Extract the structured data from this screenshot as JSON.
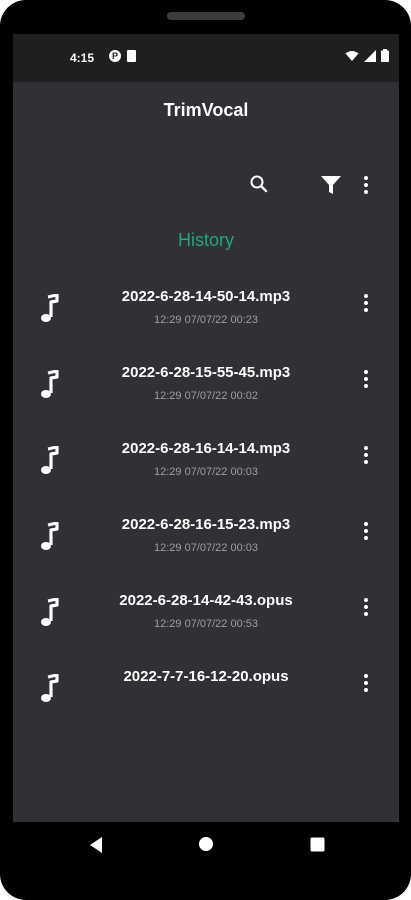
{
  "status_bar": {
    "time": "4:15",
    "app_icons": [
      "p-icon",
      "sd-card-icon"
    ],
    "right_icons": [
      "wifi-icon",
      "signal-icon",
      "battery-icon"
    ]
  },
  "app": {
    "title": "TrimVocal"
  },
  "toolbar": {
    "icons": [
      "search-icon",
      "filter-icon",
      "more-vert-icon"
    ]
  },
  "section": {
    "title": "History"
  },
  "recordings": [
    {
      "name": "2022-6-28-14-50-14.mp3",
      "meta": "12:29 07/07/22  00:23"
    },
    {
      "name": "2022-6-28-15-55-45.mp3",
      "meta": "12:29 07/07/22  00:02"
    },
    {
      "name": "2022-6-28-16-14-14.mp3",
      "meta": "12:29 07/07/22  00:03"
    },
    {
      "name": "2022-6-28-16-15-23.mp3",
      "meta": "12:29 07/07/22  00:03"
    },
    {
      "name": "2022-6-28-14-42-43.opus",
      "meta": "12:29 07/07/22  00:53"
    },
    {
      "name": "2022-7-7-16-12-20.opus",
      "meta": ""
    }
  ],
  "colors": {
    "background": "#303035",
    "status_bar": "#1f1f22",
    "accent": "#23a77b",
    "meta_text": "#9e9ea3"
  },
  "nav": {
    "icons": [
      "back-icon",
      "home-icon",
      "recents-icon"
    ]
  }
}
